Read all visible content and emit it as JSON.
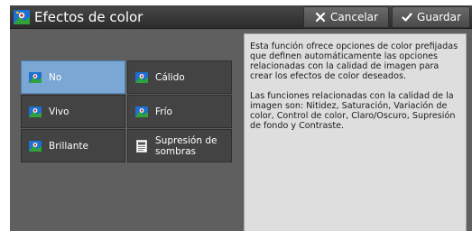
{
  "window": {
    "title": "Efectos de color",
    "title_icon": "color-effects-icon"
  },
  "toolbar": {
    "cancel_label": "Cancelar",
    "cancel_icon": "close-icon",
    "save_label": "Guardar",
    "save_icon": "checkmark-icon"
  },
  "options": [
    {
      "label": "No",
      "icon": "color-effect-icon",
      "selected": true
    },
    {
      "label": "Cálido",
      "icon": "color-effect-icon",
      "selected": false
    },
    {
      "label": "Vivo",
      "icon": "color-effect-icon",
      "selected": false
    },
    {
      "label": "Frío",
      "icon": "color-effect-icon",
      "selected": false
    },
    {
      "label": "Brillante",
      "icon": "color-effect-icon",
      "selected": false
    },
    {
      "label": "Supresión de sombras",
      "icon": "document-page-icon",
      "selected": false
    }
  ],
  "description": {
    "paragraph1": "Esta función ofrece opciones de color prefijadas que definen automáticamente las opciones relacionadas con la calidad de imagen para crear los efectos de color deseados.",
    "paragraph2": "Las funciones relacionadas con la calidad de la imagen son: Nitidez, Saturación, Variación de color, Control de color, Claro/Oscuro, Supresión de fondo y Contraste."
  },
  "colors": {
    "selected": "#7aa7d4",
    "button": "#434343",
    "panel": "#5f5f5f",
    "info_background": "#dedede"
  }
}
